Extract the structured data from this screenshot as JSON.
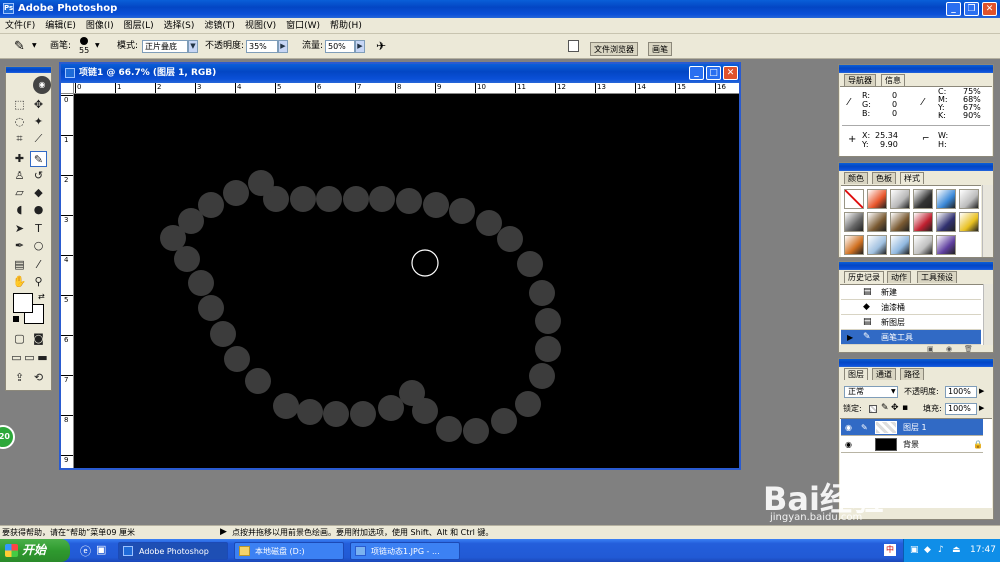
{
  "app": {
    "title": "Adobe Photoshop",
    "accent": "#0346c4"
  },
  "menu": [
    "文件(F)",
    "编辑(E)",
    "图像(I)",
    "图层(L)",
    "选择(S)",
    "滤镜(T)",
    "视图(V)",
    "窗口(W)",
    "帮助(H)"
  ],
  "options": {
    "brush_label": "画笔:",
    "brush_size": "55",
    "mode_label": "模式:",
    "mode_value": "正片叠底",
    "opacity_label": "不透明度:",
    "opacity_value": "35%",
    "flow_label": "流量:",
    "flow_value": "50%",
    "palette_tabs": [
      "文件浏览器",
      "画笔"
    ]
  },
  "document": {
    "title": "项链1 @ 66.7% (图层 1, RGB)",
    "ruler_h": [
      "0",
      "1",
      "2",
      "3",
      "4",
      "5",
      "6",
      "7",
      "8",
      "9",
      "10",
      "11",
      "12",
      "13",
      "14",
      "15",
      "16"
    ],
    "ruler_v": [
      "0",
      "1",
      "2",
      "3",
      "4",
      "5",
      "6",
      "7",
      "8",
      "9"
    ],
    "canvas_color": "#000000",
    "bead_color": "#3c3c3c"
  },
  "toolbox": {
    "badge": "20"
  },
  "navigator": {
    "tabs": [
      "导航器",
      "信息"
    ],
    "rgb": [
      {
        "k": "R:",
        "v": "0"
      },
      {
        "k": "G:",
        "v": "0"
      },
      {
        "k": "B:",
        "v": "0"
      }
    ],
    "cmyk": [
      {
        "k": "C:",
        "v": "75%"
      },
      {
        "k": "M:",
        "v": "68%"
      },
      {
        "k": "Y:",
        "v": "67%"
      },
      {
        "k": "K:",
        "v": "90%"
      }
    ],
    "xy": [
      {
        "k": "X:",
        "v": "25.34"
      },
      {
        "k": "Y:",
        "v": "9.90"
      }
    ],
    "wh": [
      {
        "k": "W:",
        "v": ""
      },
      {
        "k": "H:",
        "v": ""
      }
    ]
  },
  "styles": {
    "tabs": [
      "颜色",
      "色板",
      "样式"
    ]
  },
  "history": {
    "tabs": [
      "历史记录",
      "动作",
      "工具预设"
    ],
    "items": [
      "新建",
      "油漆桶",
      "新图层",
      "画笔工具"
    ]
  },
  "layers": {
    "tabs": [
      "图层",
      "通道",
      "路径"
    ],
    "blend": "正常",
    "opacity_label": "不透明度:",
    "opacity": "100%",
    "lock_label": "锁定:",
    "fill_label": "填充:",
    "fill": "100%",
    "items": [
      "图层 1",
      "背景"
    ]
  },
  "status": {
    "left": "要获得帮助，请在“帮助”菜单09 厘米",
    "right": "点按并拖移以用前景色绘画。要用附加选项，使用 Shift、Alt 和 Ctrl 键。"
  },
  "taskbar": {
    "start": "开始",
    "tasks": [
      "Adobe Photoshop",
      "本地磁盘 (D:)",
      "项链动态1.JPG - ..."
    ],
    "time": "17:47"
  },
  "watermark": {
    "text": "Bai经验",
    "sub": "jingyan.baidu.com"
  }
}
